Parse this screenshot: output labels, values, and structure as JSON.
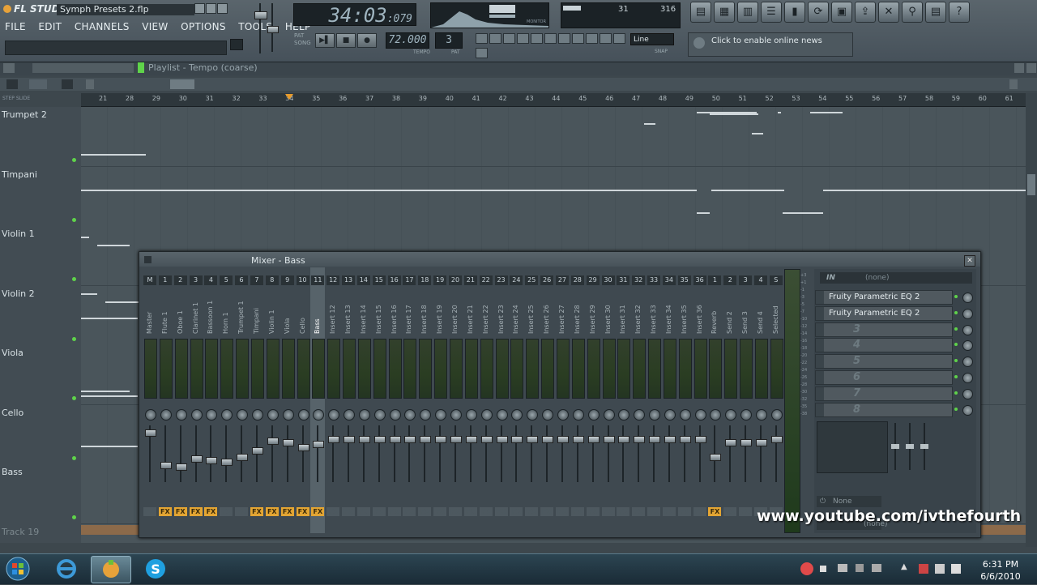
{
  "app": {
    "logo": "FL STUDIO",
    "file_title": "Symph Presets 2.flp",
    "menu": [
      "FILE",
      "EDIT",
      "CHANNELS",
      "VIEW",
      "OPTIONS",
      "TOOLS",
      "HELP"
    ]
  },
  "transport": {
    "time_main": "34:03",
    "time_ms": ":079",
    "pat_label": "PAT",
    "song_label": "SONG",
    "tempo": "72.000",
    "tempo_label": "TEMPO",
    "pattern": "3",
    "pattern_label": "PAT",
    "monitor_label": "MONITOR",
    "cpu_value": "31",
    "poly_value": "316",
    "snap_value": "Line",
    "snap_label": "SNAP",
    "news_text": "Click to enable online news"
  },
  "playlist": {
    "title": "Playlist - Tempo (coarse)",
    "step_label": "STEP",
    "slide_label": "SLIDE",
    "ruler_ticks": [
      "21",
      "28",
      "29",
      "30",
      "31",
      "32",
      "33",
      "34",
      "35",
      "36",
      "37",
      "38",
      "39",
      "40",
      "41",
      "42",
      "43",
      "44",
      "45",
      "46",
      "47",
      "48",
      "49",
      "50",
      "51",
      "52",
      "53",
      "54",
      "55",
      "56",
      "57",
      "58",
      "59",
      "60",
      "61"
    ],
    "tracks": [
      {
        "label": "Trumpet 2"
      },
      {
        "label": "Timpani"
      },
      {
        "label": "Violin 1"
      },
      {
        "label": "Violin 2"
      },
      {
        "label": "Viola"
      },
      {
        "label": "Cello"
      },
      {
        "label": "Bass"
      },
      {
        "label": "Track 19"
      }
    ]
  },
  "mixer": {
    "title": "Mixer - Bass",
    "in_label": "IN",
    "in_value": "(none)",
    "strips": [
      {
        "num": "M",
        "name": "Master",
        "fx": false
      },
      {
        "num": "1",
        "name": "Flute 1",
        "fx": true
      },
      {
        "num": "2",
        "name": "Oboe 1",
        "fx": true
      },
      {
        "num": "3",
        "name": "Clarinet 1",
        "fx": true
      },
      {
        "num": "4",
        "name": "Bassoon 1",
        "fx": true
      },
      {
        "num": "5",
        "name": "Horn 1",
        "fx": false
      },
      {
        "num": "6",
        "name": "Trumpet 1",
        "fx": false
      },
      {
        "num": "7",
        "name": "Timpani",
        "fx": true
      },
      {
        "num": "8",
        "name": "Violin 1",
        "fx": true
      },
      {
        "num": "9",
        "name": "Viola",
        "fx": true
      },
      {
        "num": "10",
        "name": "Cello",
        "fx": true
      },
      {
        "num": "11",
        "name": "Bass",
        "fx": true,
        "selected": true
      },
      {
        "num": "12",
        "name": "Insert 12",
        "fx": false
      },
      {
        "num": "13",
        "name": "Insert 13",
        "fx": false
      },
      {
        "num": "14",
        "name": "Insert 14",
        "fx": false
      },
      {
        "num": "15",
        "name": "Insert 15",
        "fx": false
      },
      {
        "num": "16",
        "name": "Insert 16",
        "fx": false
      },
      {
        "num": "17",
        "name": "Insert 17",
        "fx": false
      },
      {
        "num": "18",
        "name": "Insert 18",
        "fx": false
      },
      {
        "num": "19",
        "name": "Insert 19",
        "fx": false
      },
      {
        "num": "20",
        "name": "Insert 20",
        "fx": false
      },
      {
        "num": "21",
        "name": "Insert 21",
        "fx": false
      },
      {
        "num": "22",
        "name": "Insert 22",
        "fx": false
      },
      {
        "num": "23",
        "name": "Insert 23",
        "fx": false
      },
      {
        "num": "24",
        "name": "Insert 24",
        "fx": false
      },
      {
        "num": "25",
        "name": "Insert 25",
        "fx": false
      },
      {
        "num": "26",
        "name": "Insert 26",
        "fx": false
      },
      {
        "num": "27",
        "name": "Insert 27",
        "fx": false
      },
      {
        "num": "28",
        "name": "Insert 28",
        "fx": false
      },
      {
        "num": "29",
        "name": "Insert 29",
        "fx": false
      },
      {
        "num": "30",
        "name": "Insert 30",
        "fx": false
      },
      {
        "num": "31",
        "name": "Insert 31",
        "fx": false
      },
      {
        "num": "32",
        "name": "Insert 32",
        "fx": false
      },
      {
        "num": "33",
        "name": "Insert 33",
        "fx": false
      },
      {
        "num": "34",
        "name": "Insert 34",
        "fx": false
      },
      {
        "num": "35",
        "name": "Insert 35",
        "fx": false
      },
      {
        "num": "36",
        "name": "Insert 36",
        "fx": false
      },
      {
        "num": "1",
        "name": "Reverb",
        "fx": true
      },
      {
        "num": "2",
        "name": "Send 2",
        "fx": false
      },
      {
        "num": "3",
        "name": "Send 3",
        "fx": false
      },
      {
        "num": "4",
        "name": "Send 4",
        "fx": false
      },
      {
        "num": "S",
        "name": "Selected",
        "fx": false
      }
    ],
    "fx_slots": [
      {
        "label": "Fruity Parametric EQ 2"
      },
      {
        "label": "Fruity Parametric EQ 2"
      },
      {
        "label": "3"
      },
      {
        "label": "4"
      },
      {
        "label": "5"
      },
      {
        "label": "6"
      },
      {
        "label": "7"
      },
      {
        "label": "8"
      }
    ],
    "out_value": "None",
    "out_value2": "(none)",
    "db_scale": [
      "+3",
      "+1",
      "-1",
      "-3",
      "-5",
      "-7",
      "-10",
      "-12",
      "-14",
      "-16",
      "-18",
      "-20",
      "-22",
      "-24",
      "-26",
      "-28",
      "-30",
      "-32",
      "-35",
      "-38"
    ]
  },
  "watermark": "www.youtube.com/ivthefourth",
  "taskbar": {
    "time": "6:31 PM",
    "date": "6/6/2010"
  }
}
